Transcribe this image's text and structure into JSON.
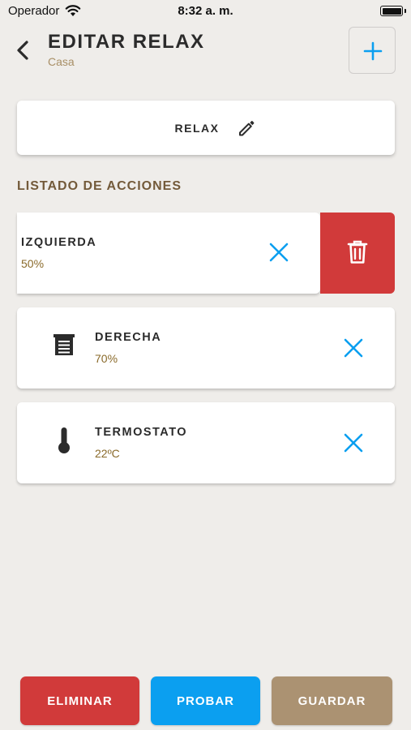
{
  "status_bar": {
    "carrier": "Operador",
    "time": "8:32 a. m."
  },
  "header": {
    "title": "EDITAR RELAX",
    "subtitle": "Casa"
  },
  "scene_name": "RELAX",
  "section_title": "LISTADO DE ACCIONES",
  "actions": [
    {
      "name": "IZQUIERDA",
      "value": "50%",
      "icon": "none"
    },
    {
      "name": "DERECHA",
      "value": "70%",
      "icon": "blind-icon"
    },
    {
      "name": "TERMOSTATO",
      "value": "22ºC",
      "icon": "thermometer-icon"
    }
  ],
  "buttons": {
    "delete": "ELIMINAR",
    "test": "PROBAR",
    "save": "GUARDAR"
  },
  "colors": {
    "background": "#efedea",
    "accent_blue": "#0b9ff0",
    "danger_red": "#d13a3a",
    "save_brown": "#ab9272",
    "subtitle_gold": "#a88f66"
  }
}
